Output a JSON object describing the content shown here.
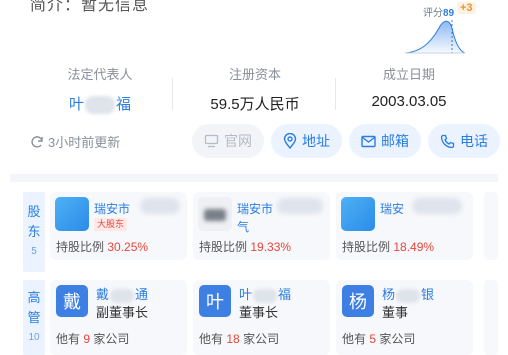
{
  "header": {
    "intro_text": "简介：暂无信息",
    "score": {
      "label": "评分",
      "value": "89",
      "delta": "+3"
    }
  },
  "info": {
    "legal_rep": {
      "label": "法定代表人",
      "name_first": "叶",
      "name_last": "福"
    },
    "capital": {
      "label": "注册资本",
      "value": "59.5万人民币"
    },
    "established": {
      "label": "成立日期",
      "value": "2003.03.05"
    }
  },
  "update": {
    "text": "3小时前更新",
    "icon": "refresh-icon"
  },
  "actions": [
    {
      "label": "官网",
      "icon": "monitor-icon",
      "enabled": false
    },
    {
      "label": "地址",
      "icon": "location-pin-icon",
      "enabled": true
    },
    {
      "label": "邮箱",
      "icon": "mail-icon",
      "enabled": true
    },
    {
      "label": "电话",
      "icon": "phone-icon",
      "enabled": true
    }
  ],
  "shareholders": {
    "tab_label_1": "股",
    "tab_label_2": "东",
    "count": "5",
    "items": [
      {
        "name": "瑞安市",
        "tag": "大股东",
        "ratio_label": "持股比例",
        "ratio": "30.25%",
        "ratio_value": 30.25
      },
      {
        "name": "瑞安市",
        "sub": "气",
        "ratio_label": "持股比例",
        "ratio": "19.33%",
        "ratio_value": 19.33
      },
      {
        "name": "瑞安",
        "ratio_label": "持股比例",
        "ratio": "18.49%",
        "ratio_value": 18.49
      }
    ]
  },
  "executives": {
    "tab_label_1": "高",
    "tab_label_2": "管",
    "count": "10",
    "items": [
      {
        "avatar": "戴",
        "name_a": "戴",
        "name_b": "通",
        "role": "副董事长",
        "stat_prefix": "他有",
        "stat_count": "9",
        "stat_suffix": "家公司"
      },
      {
        "avatar": "叶",
        "name_a": "叶",
        "name_b": "福",
        "role": "董事长",
        "stat_prefix": "他有",
        "stat_count": "18",
        "stat_suffix": "家公司"
      },
      {
        "avatar": "杨",
        "name_a": "杨",
        "name_b": "银",
        "role": "董事",
        "stat_prefix": "他有",
        "stat_count": "5",
        "stat_suffix": "家公司"
      }
    ]
  },
  "colors": {
    "accent": "#2a7de1",
    "highlight": "#e8453a",
    "score_delta": "#e8952f"
  }
}
